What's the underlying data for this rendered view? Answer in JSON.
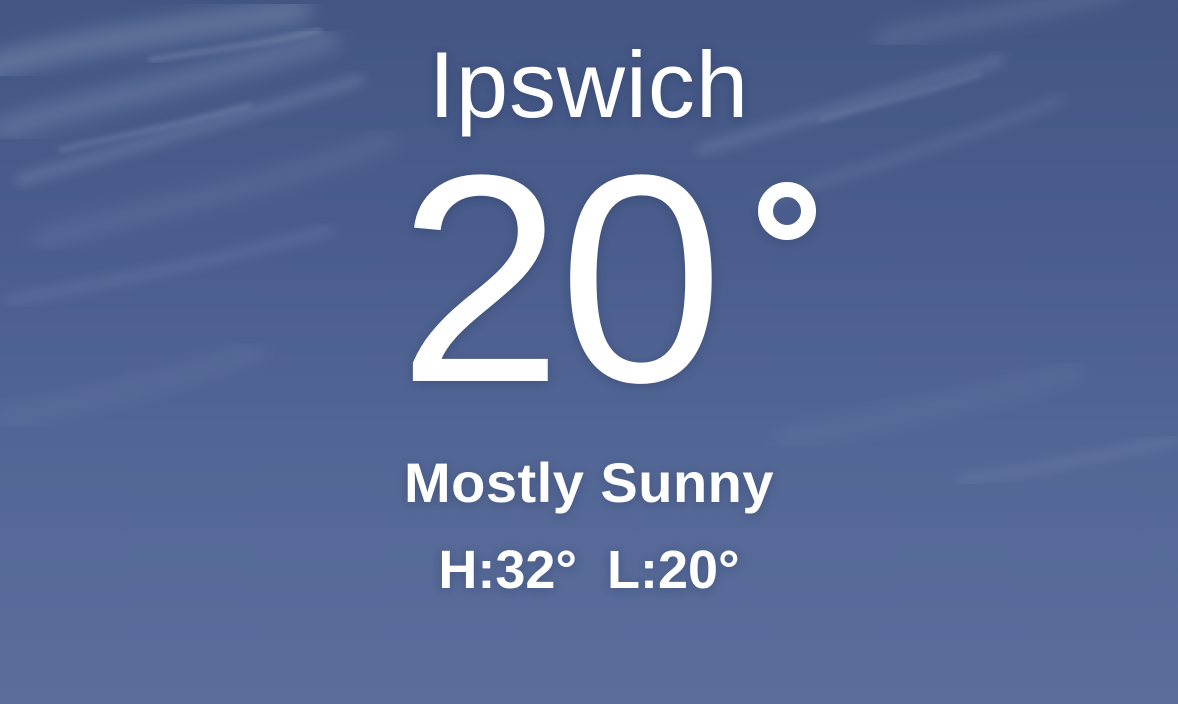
{
  "location": {
    "city": "Ipswich"
  },
  "current": {
    "temperature": "20",
    "degree_symbol": "°",
    "condition": "Mostly Sunny"
  },
  "forecast": {
    "high_label": "H:32°",
    "low_label": "L:20°"
  },
  "colors": {
    "sky_top": "#435683",
    "sky_bottom": "#5b6d9b",
    "text": "#ffffff"
  },
  "icons": {
    "degree": "degree-symbol"
  }
}
